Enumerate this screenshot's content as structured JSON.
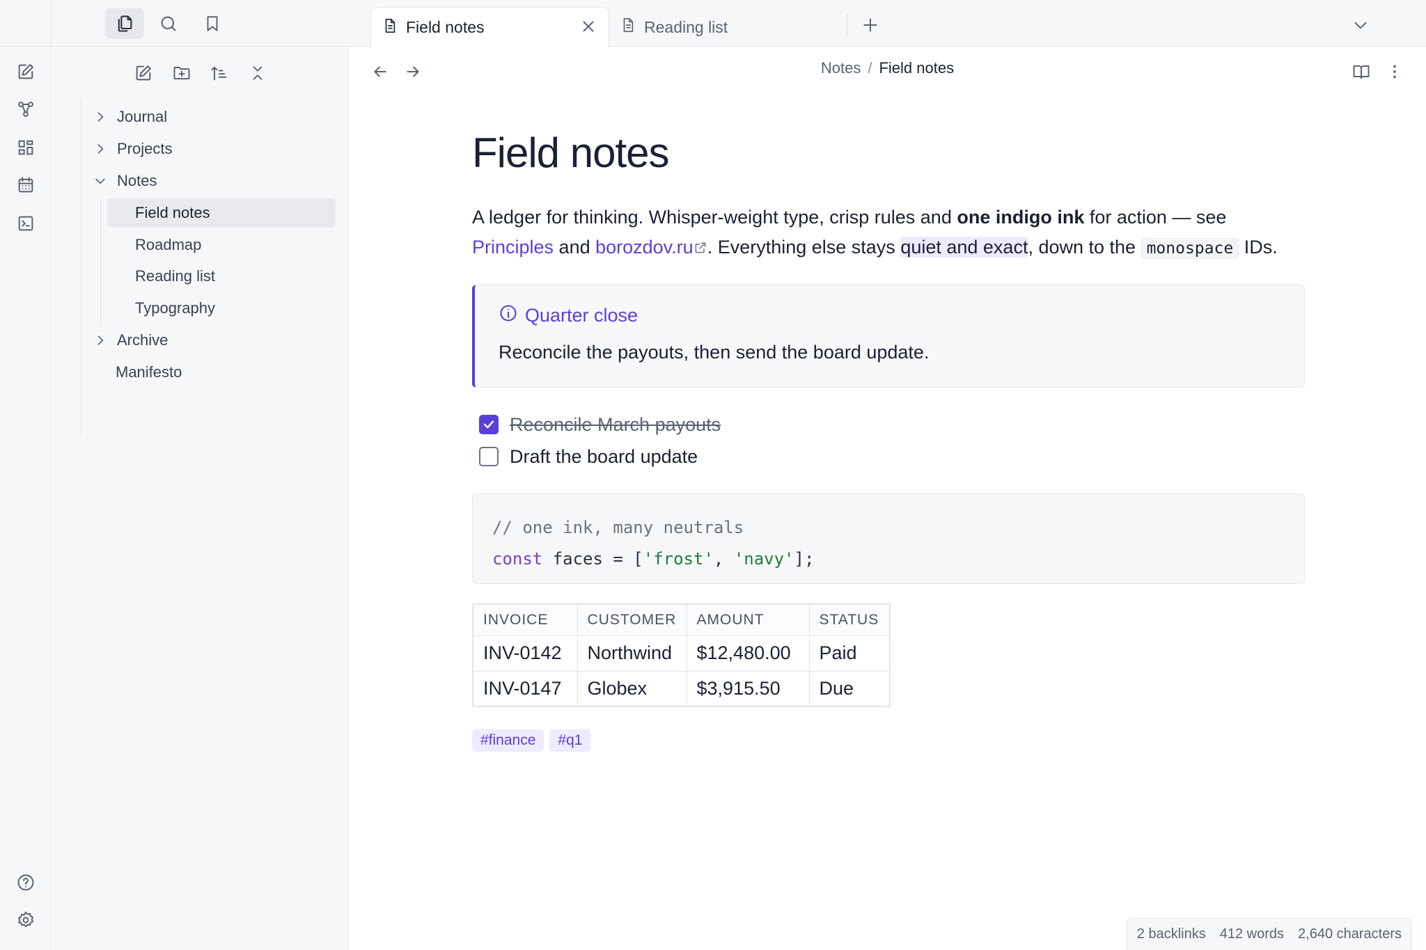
{
  "tabs": [
    {
      "label": "Field notes",
      "active": true,
      "icon": "file-icon"
    },
    {
      "label": "Reading list",
      "active": false,
      "icon": "file-icon"
    }
  ],
  "sidebar": {
    "tree": [
      {
        "label": "Journal",
        "chevron": "right"
      },
      {
        "label": "Projects",
        "chevron": "right"
      },
      {
        "label": "Notes",
        "chevron": "down"
      },
      {
        "label": "Field notes",
        "active": true
      },
      {
        "label": "Roadmap"
      },
      {
        "label": "Reading list"
      },
      {
        "label": "Typography"
      },
      {
        "label": "Archive",
        "chevron": "right"
      },
      {
        "label": "Manifesto"
      }
    ]
  },
  "breadcrumb": {
    "parent": "Notes",
    "separator": "/",
    "current": "Field notes"
  },
  "document": {
    "title": "Field notes",
    "para": {
      "t1": "A ledger for thinking. Whisper-weight type, crisp rules and ",
      "bold": "one indigo ink",
      "t2": " for action — see ",
      "link1": "Principles",
      "t3": " and ",
      "link2": "borozdov.ru",
      "t4": ". Everything else stays ",
      "highlight": "quiet and exact",
      "t5": ", down to the ",
      "code": "monospace",
      "t6": " IDs."
    },
    "callout": {
      "title": "Quarter close",
      "body": "Reconcile the payouts, then send the board update."
    },
    "tasks": [
      {
        "text": "Reconcile March payouts",
        "done": true
      },
      {
        "text": "Draft the board update",
        "done": false
      }
    ],
    "code": {
      "comment": "// one ink, many neutrals",
      "keyword": "const",
      "t1": " faces = [",
      "s1": "'frost'",
      "t2": ", ",
      "s2": "'navy'",
      "t3": "];"
    },
    "table": {
      "headers": [
        "INVOICE",
        "CUSTOMER",
        "AMOUNT",
        "STATUS"
      ],
      "rows": [
        [
          "INV-0142",
          "Northwind",
          "$12,480.00",
          "Paid"
        ],
        [
          "INV-0147",
          "Globex",
          "$3,915.50",
          "Due"
        ]
      ]
    },
    "tags": [
      "#finance",
      "#q1"
    ]
  },
  "status": {
    "backlinks": "2 backlinks",
    "words": "412 words",
    "chars": "2,640 characters"
  },
  "colors": {
    "accent": "#5b3fd9",
    "panel": "#f6f7f9",
    "text": "#1b2133"
  }
}
